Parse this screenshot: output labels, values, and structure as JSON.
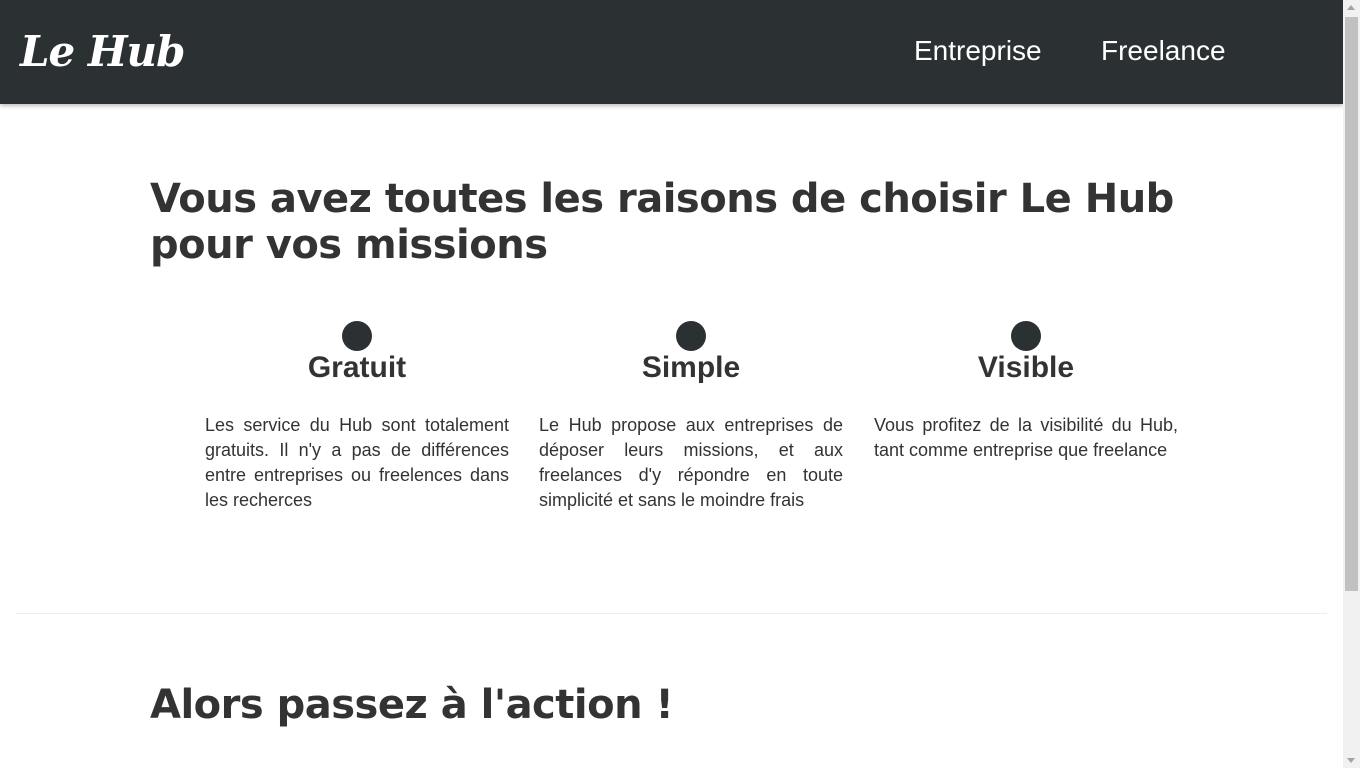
{
  "navbar": {
    "brand": "Le Hub",
    "links": [
      {
        "label": "Entreprise"
      },
      {
        "label": "Freelance"
      }
    ]
  },
  "main": {
    "title": "Vous avez toutes les raisons de choisir Le Hub pour vos missions",
    "features": [
      {
        "title": "Gratuit",
        "text": "Les service du Hub sont totalement gratuits. Il n'y a pas de différences entre entreprises ou freelences dans les recherces"
      },
      {
        "title": "Simple",
        "text": "Le Hub propose aux entreprises de déposer leurs missions, et aux freelances d'y répondre en toute simplicité et sans le moindre frais"
      },
      {
        "title": "Visible",
        "text": "Vous profitez de la visibilité du Hub, tant comme entreprise que freelance"
      }
    ],
    "action_title": "Alors passez à l'action !"
  },
  "colors": {
    "navbar_bg": "#2b3133",
    "text": "#333333",
    "dot": "#2b3133",
    "divider": "#eeeeee"
  }
}
